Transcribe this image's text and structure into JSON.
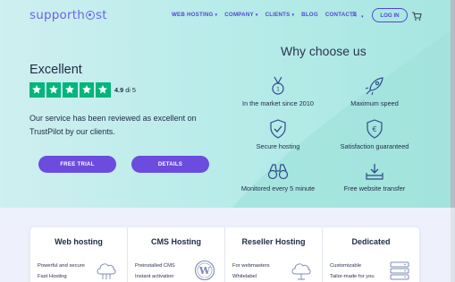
{
  "header": {
    "logo": {
      "before": "supporth",
      "after": "st"
    },
    "nav": [
      {
        "label": "WEB HOSTING",
        "caret": true
      },
      {
        "label": "COMPANY",
        "caret": true
      },
      {
        "label": "CLIENTS",
        "caret": true
      },
      {
        "label": "BLOG",
        "caret": false
      },
      {
        "label": "CONTACTS",
        "caret": false
      }
    ],
    "language_icon": "translate-icon",
    "login_label": "LOG IN",
    "cart_icon": "cart-icon"
  },
  "hero": {
    "rating_word": "Excellent",
    "stars": 5,
    "rating_value": "4.9",
    "rating_suffix": "di 5",
    "review_text": "Our service has been reviewed as excellent on TrustPilot by our clients.",
    "btn_trial": "FREE TRIAL",
    "btn_details": "DETAILS",
    "why_title": "Why choose us",
    "features": [
      {
        "label": "In the market since 2010",
        "icon": "medal-icon"
      },
      {
        "label": "Maximum speed",
        "icon": "rocket-icon"
      },
      {
        "label": "Secure hosting",
        "icon": "shield-check-icon"
      },
      {
        "label": "Satisfaction guaranteed",
        "icon": "euro-shield-icon"
      },
      {
        "label": "Monitored every 5 minute",
        "icon": "binoculars-icon"
      },
      {
        "label": "Free website transfer",
        "icon": "download-tray-icon"
      }
    ]
  },
  "cards": [
    {
      "title": "Web hosting",
      "lines": [
        "Powerful and secure",
        "Fast Hosting"
      ],
      "icon": "cloud-icon"
    },
    {
      "title": "CMS Hosting",
      "lines": [
        "Preinstalled CMS",
        "Instant activation"
      ],
      "icon": "wordpress-icon"
    },
    {
      "title": "Reseller Hosting",
      "lines": [
        "For webmasters",
        "Whitelabel"
      ],
      "icon": "cloud-icon"
    },
    {
      "title": "Dedicated",
      "lines": [
        "Customizable",
        "Tailor-made for you"
      ],
      "icon": "server-icon"
    }
  ],
  "colors": {
    "brand": "#6c63e6",
    "button": "#6c4bdf",
    "trustpilot_green": "#00b67a",
    "icon_blue": "#2f4a8a"
  }
}
